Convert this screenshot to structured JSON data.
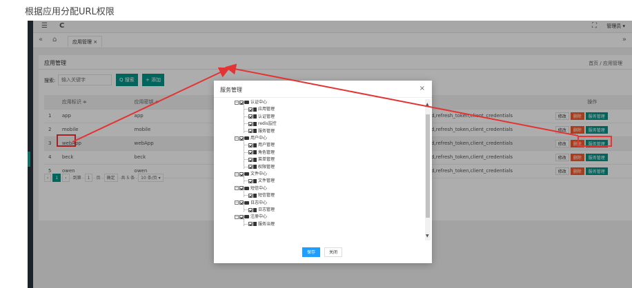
{
  "caption": "根据应用分配URL权限",
  "topbar": {
    "menu_icon": "☰",
    "refresh_icon": "C",
    "fullscreen_icon": "⛶",
    "user": "管理员 ▾"
  },
  "tabs": {
    "back": "«",
    "home_icon": "⌂",
    "tab_label": "应用管理 ×",
    "more": "»"
  },
  "panel": {
    "title": "应用管理",
    "breadcrumb": "首页 / 应用管理",
    "search_label": "搜索:",
    "search_placeholder": "输入关键字",
    "search_button": "Q 搜索",
    "add_button": "+ 添加"
  },
  "table": {
    "headers": [
      "",
      "应用标识 ≑",
      "应用密钥 ≑",
      "",
      "操作"
    ],
    "rows": [
      {
        "idx": "1",
        "id": "app",
        "secret": "app",
        "grant": "e,password,refresh_token,client_credentials"
      },
      {
        "idx": "2",
        "id": "mobile",
        "secret": "mobile",
        "grant": "e,password,refresh_token,client_credentials"
      },
      {
        "idx": "3",
        "id": "webApp",
        "secret": "webApp",
        "grant": "e,password,refresh_token,client_credentials"
      },
      {
        "idx": "4",
        "id": "beck",
        "secret": "beck",
        "grant": "e,password,refresh_token,client_credentials"
      },
      {
        "idx": "5",
        "id": "owen",
        "secret": "owen",
        "grant": "e,password,refresh_token,client_credentials"
      }
    ],
    "ops": {
      "edit": "修改",
      "delete": "删除",
      "service": "服务管理"
    }
  },
  "pager": {
    "prev": "‹",
    "current": "1",
    "next": "›",
    "goto": "到第",
    "page_input": "1",
    "page_unit": "页",
    "confirm": "确定",
    "total": "共 5 条",
    "page_size": "10 条/页 ▾"
  },
  "modal": {
    "title": "服务管理",
    "close": "×",
    "save": "保存",
    "cancel": "关闭",
    "tree": [
      {
        "label": "认证中心",
        "children": [
          "应用管理",
          "认证管理",
          "redis监控",
          "服务管理"
        ]
      },
      {
        "label": "用户中心",
        "children": [
          "用户管理",
          "角色管理",
          "菜单管理",
          "权限管理"
        ]
      },
      {
        "label": "文件中心",
        "children": [
          "文件管理"
        ]
      },
      {
        "label": "短信中心",
        "children": [
          "短信管理"
        ]
      },
      {
        "label": "日志中心",
        "children": [
          "日志管理"
        ]
      },
      {
        "label": "注册中心",
        "children": [
          "服务治理"
        ]
      }
    ]
  },
  "colors": {
    "annotation": "#e33333",
    "primary": "#009688",
    "save": "#1e9fff",
    "danger": "#ff5722"
  }
}
